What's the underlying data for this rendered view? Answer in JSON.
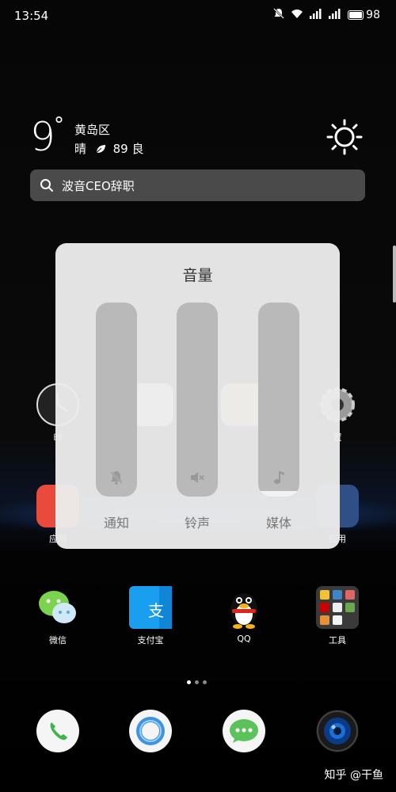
{
  "status_bar": {
    "time": "13:54",
    "network": "4G",
    "battery": "98"
  },
  "weather": {
    "temperature": "9",
    "degree": "°",
    "city": "黄岛区",
    "condition": "晴",
    "aqi": "89",
    "aqi_level": "良"
  },
  "search": {
    "text": "波音CEO辞职"
  },
  "rows": {
    "row1": [
      "时",
      "",
      "",
      "置"
    ],
    "row2": [
      "应用",
      "",
      "",
      "应用"
    ]
  },
  "apps": [
    {
      "label": "微信"
    },
    {
      "label": "支付宝"
    },
    {
      "label": "QQ"
    },
    {
      "label": "工具"
    }
  ],
  "page_indicator": {
    "current": 1,
    "total": 3
  },
  "dock": [
    "phone",
    "browser",
    "messages",
    "camera"
  ],
  "volume": {
    "title": "音量",
    "sliders": [
      {
        "label": "通知",
        "icon": "bell-muted-icon",
        "level": 0
      },
      {
        "label": "铃声",
        "icon": "speaker-muted-icon",
        "level": 0
      },
      {
        "label": "媒体",
        "icon": "music-note-icon",
        "level": 0.03
      }
    ]
  },
  "watermark": "知乎 @干鱼"
}
